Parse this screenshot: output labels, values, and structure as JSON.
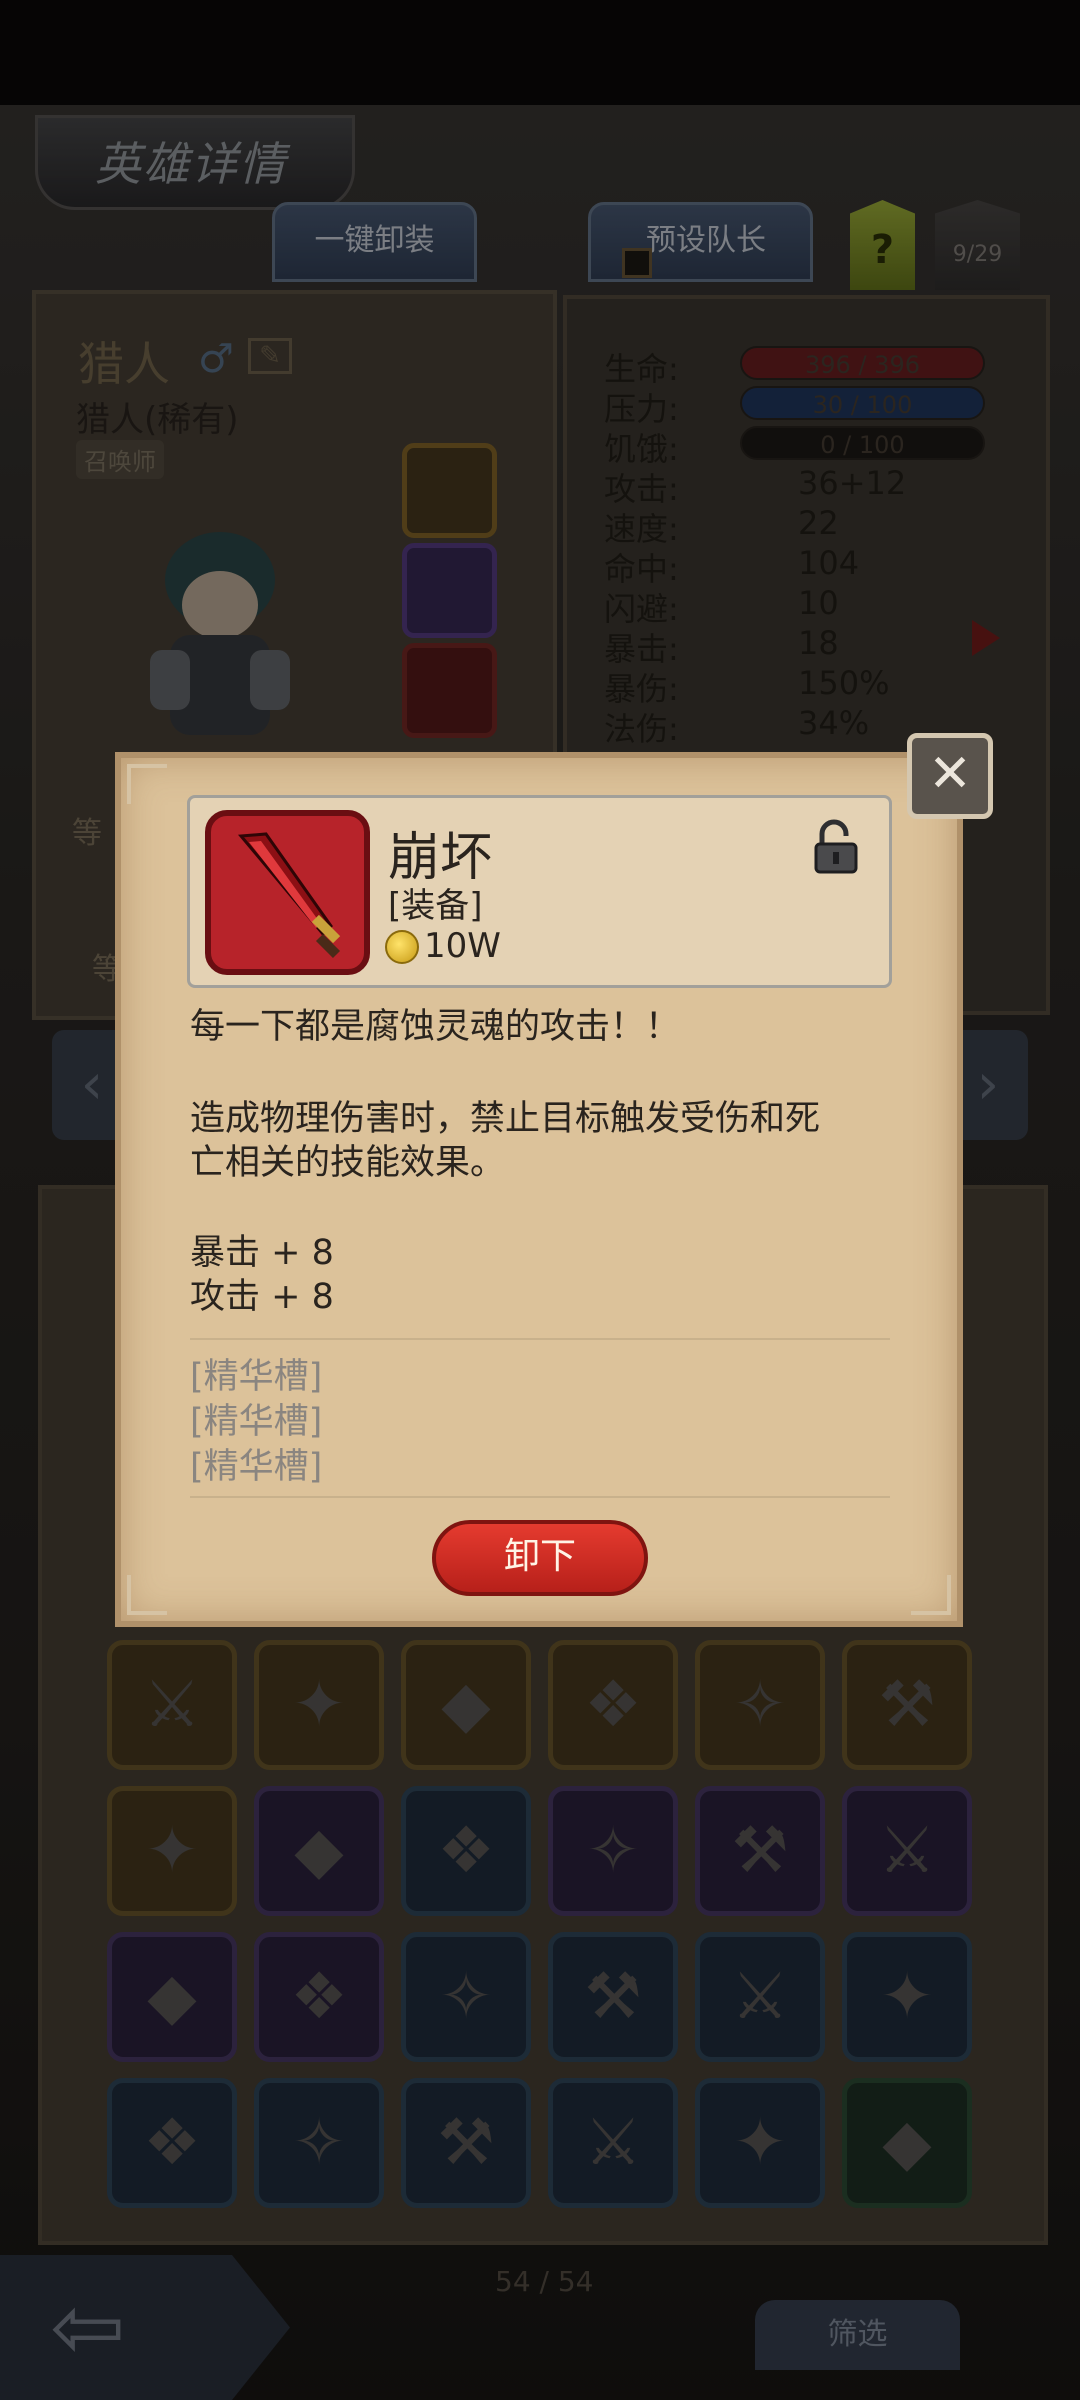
{
  "header": {
    "title": "英雄详情"
  },
  "toolbar": {
    "unequip_all": "一键卸装",
    "preset_leader": "预设队长",
    "help": "?",
    "count": "9/29"
  },
  "hero": {
    "name": "猎人",
    "class": "猎人(稀有)",
    "role": "召唤师",
    "side_label_1": "等",
    "side_label_2": "等"
  },
  "stats": [
    {
      "label": "生命:",
      "value": "396 / 396",
      "kind": "bar-red"
    },
    {
      "label": "压力:",
      "value": "30 / 100",
      "kind": "bar-blue"
    },
    {
      "label": "饥饿:",
      "value": "0 / 100",
      "kind": "bar-dark"
    },
    {
      "label": "攻击:",
      "value": "36+12"
    },
    {
      "label": "速度:",
      "value": "22"
    },
    {
      "label": "命中:",
      "value": "104"
    },
    {
      "label": "闪避:",
      "value": "10"
    },
    {
      "label": "暴击:",
      "value": "18"
    },
    {
      "label": "暴伤:",
      "value": "150%"
    },
    {
      "label": "法伤:",
      "value": "34%"
    }
  ],
  "modal": {
    "item_name": "崩坏",
    "item_type": "[装备]",
    "price": "10W",
    "flavor": "每一下都是腐蚀灵魂的攻击！！",
    "effect_line1": "造成物理伤害时，禁止目标触发受伤和死",
    "effect_line2": "亡相关的技能效果。",
    "bonus1": "暴击 + 8",
    "bonus2": "攻击 + 8",
    "sockets": [
      "[精华槽]",
      "[精华槽]",
      "[精华槽]"
    ],
    "unequip_button": "卸下",
    "close_icon": "crossed-swords-close-icon",
    "accent": "#c0282a"
  },
  "inventory": {
    "count": "54 / 54",
    "filter_button": "筛选",
    "rows": [
      [
        "gold",
        "gold",
        "gold",
        "gold",
        "gold",
        "gold"
      ],
      [
        "gold",
        "purple",
        "blue",
        "purple",
        "purple",
        "purple"
      ],
      [
        "purple",
        "purple",
        "blue",
        "blue",
        "blue",
        "blue"
      ],
      [
        "blue",
        "blue",
        "blue",
        "blue",
        "blue",
        "green"
      ]
    ]
  }
}
